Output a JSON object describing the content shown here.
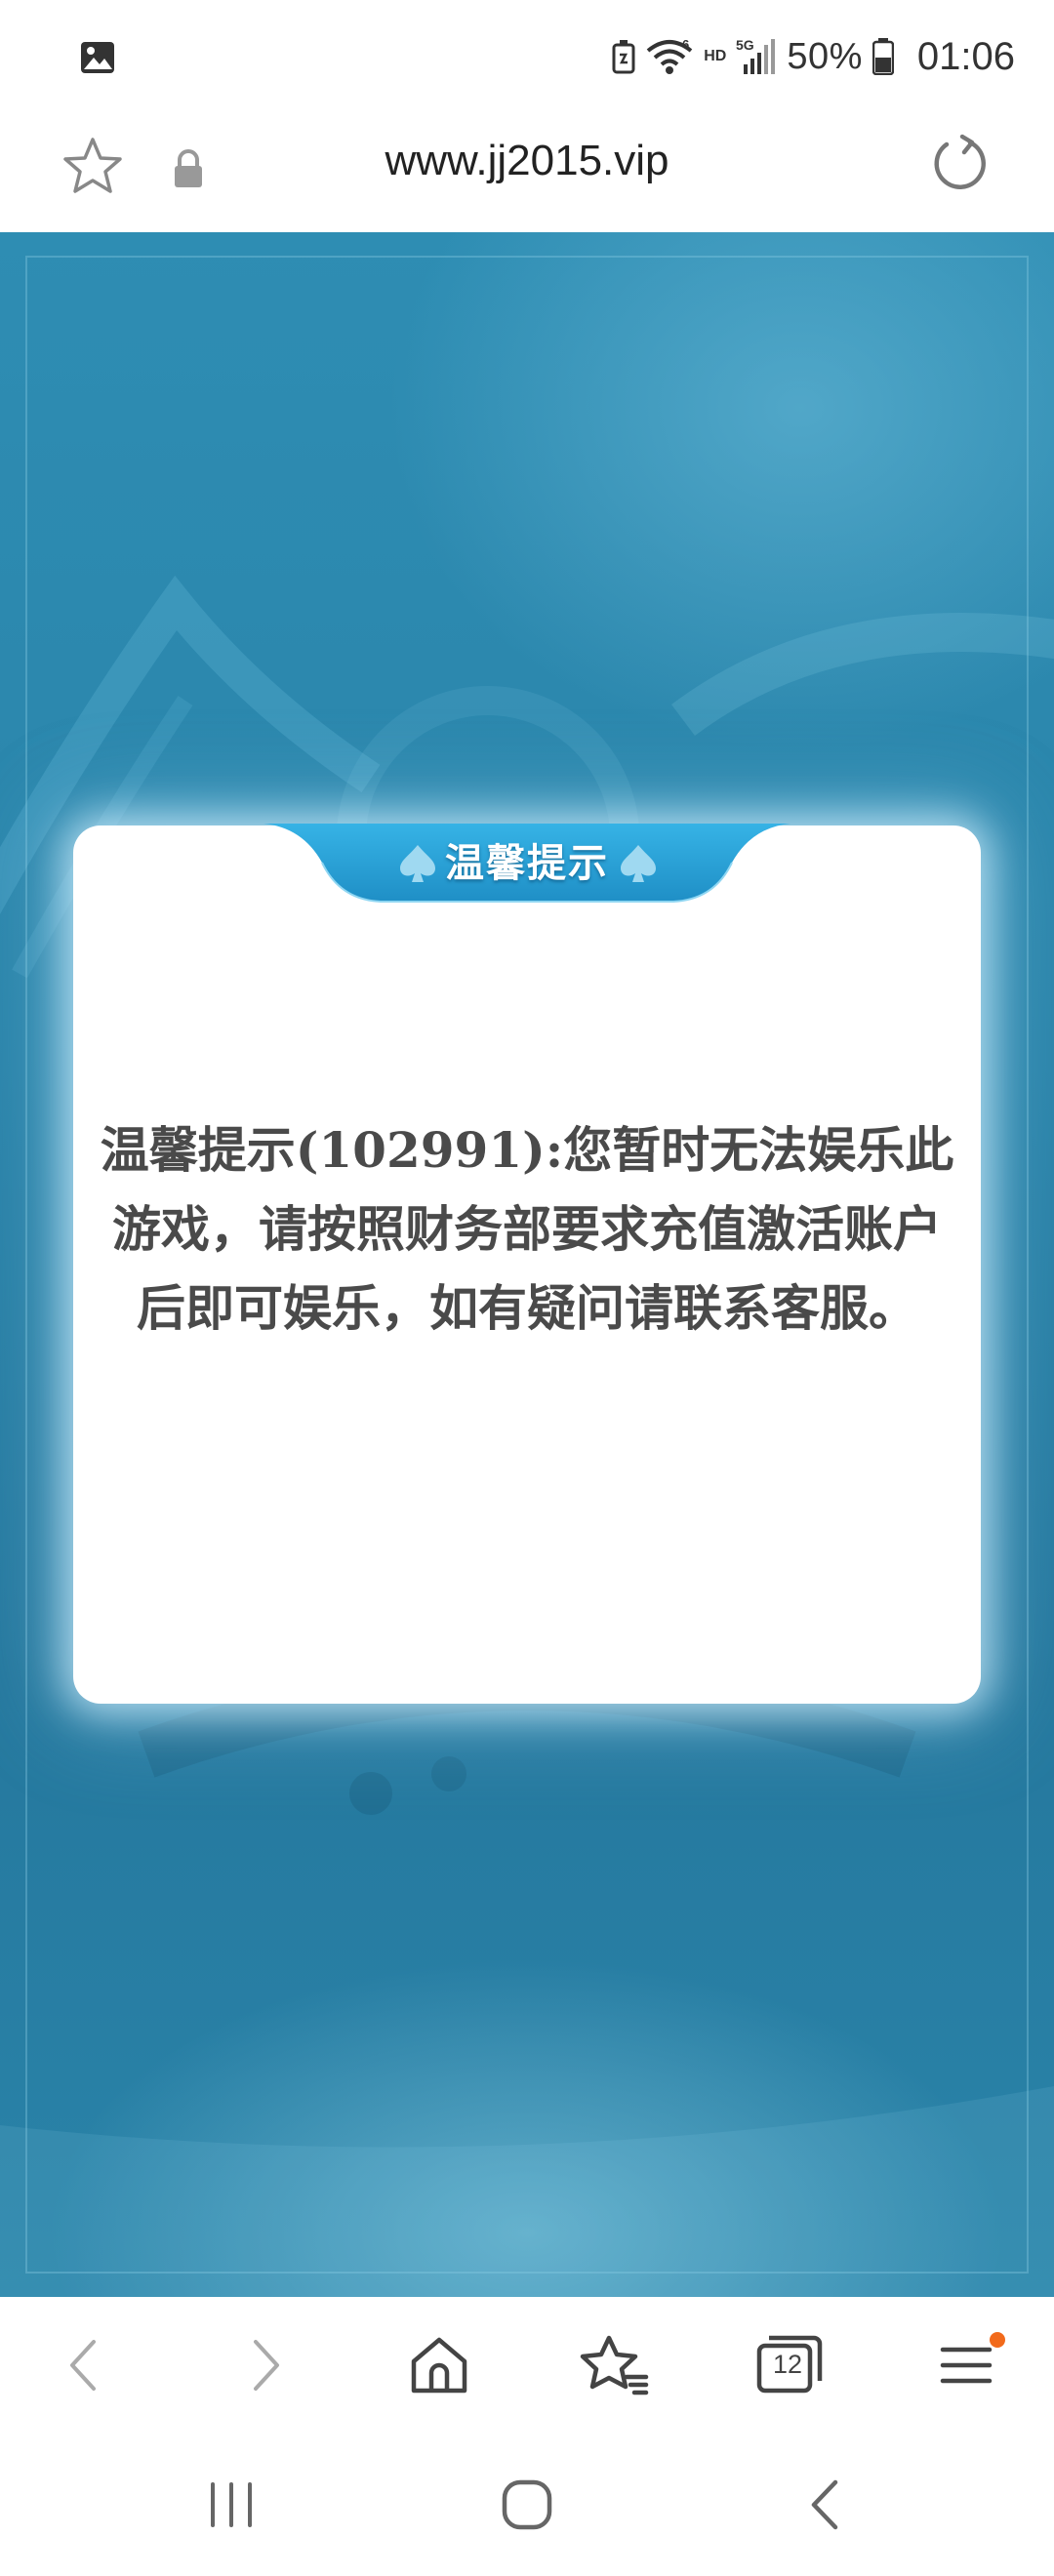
{
  "status_bar": {
    "network_hd": "HD",
    "network_gen": "5G",
    "battery_percent": "50%",
    "time": "01:06",
    "icons": [
      "gallery-icon",
      "battery-saver-icon",
      "wifi-icon",
      "signal-icon",
      "battery-icon"
    ]
  },
  "url_bar": {
    "url": "www.jj2015.vip",
    "icons": [
      "star-outline-icon",
      "lock-icon",
      "reload-icon"
    ]
  },
  "dialog": {
    "title": "温馨提示",
    "message": "温馨提示(102991):您暂时无法娱乐此游戏，请按照财务部要求充值激活账户后即可娱乐，如有疑问请联系客服。",
    "colors": {
      "tab_blue": "#2a9fd6",
      "background": "#ffffff",
      "text": "#4a4a4a"
    }
  },
  "browser_toolbar": {
    "tabs_count": "12",
    "icons": [
      "back-icon",
      "forward-icon",
      "home-icon",
      "bookmarks-icon",
      "tabs-icon",
      "menu-icon"
    ]
  },
  "system_nav": {
    "icons": [
      "recent-apps-icon",
      "home-circle-icon",
      "nav-back-icon"
    ]
  },
  "colors": {
    "page_background": "#2a84aa",
    "notification_dot": "#f26a1b"
  }
}
